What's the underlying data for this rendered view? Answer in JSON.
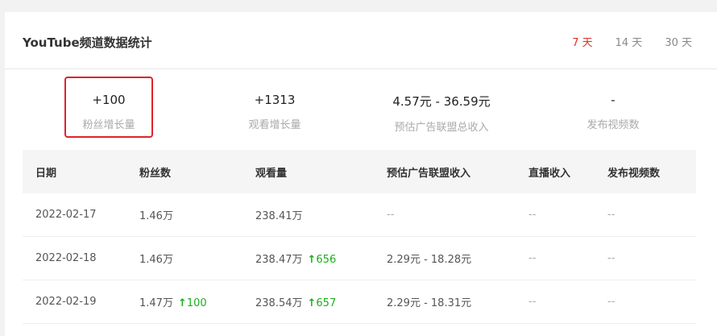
{
  "header": {
    "title": "YouTube频道数据统计",
    "ranges": [
      "7 天",
      "14 天",
      "30 天"
    ],
    "active_range": "7 天"
  },
  "stats": [
    {
      "value": "+100",
      "label": "粉丝增长量"
    },
    {
      "value": "+1313",
      "label": "观看增长量"
    },
    {
      "value": "4.57元 - 36.59元",
      "label": "预估广告联盟总收入"
    },
    {
      "value": "-",
      "label": "发布视频数"
    }
  ],
  "table": {
    "columns": [
      "日期",
      "粉丝数",
      "观看量",
      "预估广告联盟收入",
      "直播收入",
      "发布视频数"
    ],
    "rows": [
      {
        "date": "2022-02-17",
        "fans": "1.46万",
        "fans_up": "",
        "views": "238.41万",
        "views_up": "",
        "ad": "--",
        "live": "--",
        "videos": "--"
      },
      {
        "date": "2022-02-18",
        "fans": "1.46万",
        "fans_up": "",
        "views": "238.47万",
        "views_up": "656",
        "ad": "2.29元 - 18.28元",
        "live": "--",
        "videos": "--"
      },
      {
        "date": "2022-02-19",
        "fans": "1.47万",
        "fans_up": "100",
        "views": "238.54万",
        "views_up": "657",
        "ad": "2.29元 - 18.31元",
        "live": "--",
        "videos": "--"
      }
    ]
  },
  "colors": {
    "accent": "#e0301e",
    "up": "#1aad19",
    "highlight_box": "#e0232b"
  },
  "icons": {
    "up_arrow": "arrow-up-icon"
  }
}
